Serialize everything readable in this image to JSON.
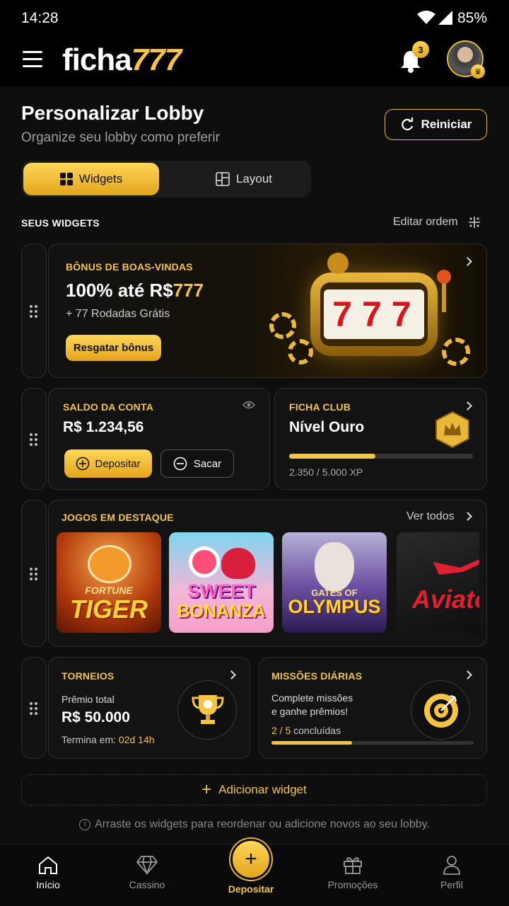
{
  "status": {
    "time": "14:28",
    "battery": "85%"
  },
  "header": {
    "logo_text": "ficha",
    "logo_num": "777",
    "notif_count": "3",
    "icons": [
      "menu-icon",
      "bell-icon",
      "avatar"
    ]
  },
  "page": {
    "title": "Personalizar Lobby",
    "subtitle": "Organize seu lobby como preferir",
    "reset_label": "Reiniciar"
  },
  "tabs": [
    {
      "label": "Widgets",
      "active": true
    },
    {
      "label": "Layout",
      "active": false
    }
  ],
  "section": {
    "title": "SEUS WIDGETS",
    "edit_label": "Editar ordem"
  },
  "bonus": {
    "title": "BÔNUS DE BOAS-VINDAS",
    "headline_prefix": "100% até R$",
    "headline_value": "777",
    "sub": "+ 77 Rodadas Grátis",
    "button": "Resgatar bônus",
    "slot_text": "777"
  },
  "balance": {
    "title": "SALDO DA CONTA",
    "amount": "R$ 1.234,56",
    "deposit": "Depositar",
    "withdraw": "Sacar"
  },
  "club": {
    "title": "FICHA CLUB",
    "level": "Nível Ouro",
    "progress": 0.47,
    "xp": "2.350 / 5.000 XP"
  },
  "games": {
    "title": "JOGOS EM DESTAQUE",
    "see_all": "Ver todos",
    "items": [
      {
        "line1": "FORTUNE",
        "line2": "TIGER"
      },
      {
        "line1": "SWEET",
        "line2": "BONANZA"
      },
      {
        "line1": "GATES OF",
        "line2": "OLYMPUS"
      },
      {
        "line1": "",
        "line2": "Aviato"
      }
    ]
  },
  "tournaments": {
    "title": "TORNEIOS",
    "prize_label": "Prêmio total",
    "prize": "R$ 50.000",
    "ends_label": "Termina em:",
    "ends_value": "02d 14h"
  },
  "missions": {
    "title": "MISSÕES DIÁRIAS",
    "desc1": "Complete missões",
    "desc2": "e ganhe prêmios!",
    "done": "2 / 5",
    "done_label": "concluídas",
    "progress": 0.4
  },
  "add_widget": "Adicionar widget",
  "hint": "Arraste os widgets para reordenar ou adicione novos ao seu lobby.",
  "nav": [
    {
      "label": "Início",
      "active": true
    },
    {
      "label": "Cassino",
      "active": false
    },
    {
      "label": "Depositar",
      "active": false
    },
    {
      "label": "Promoções",
      "active": false
    },
    {
      "label": "Perfil",
      "active": false
    }
  ],
  "colors": {
    "accent": "#f5c542",
    "bg": "#0e0e0e",
    "card": "#131313"
  }
}
